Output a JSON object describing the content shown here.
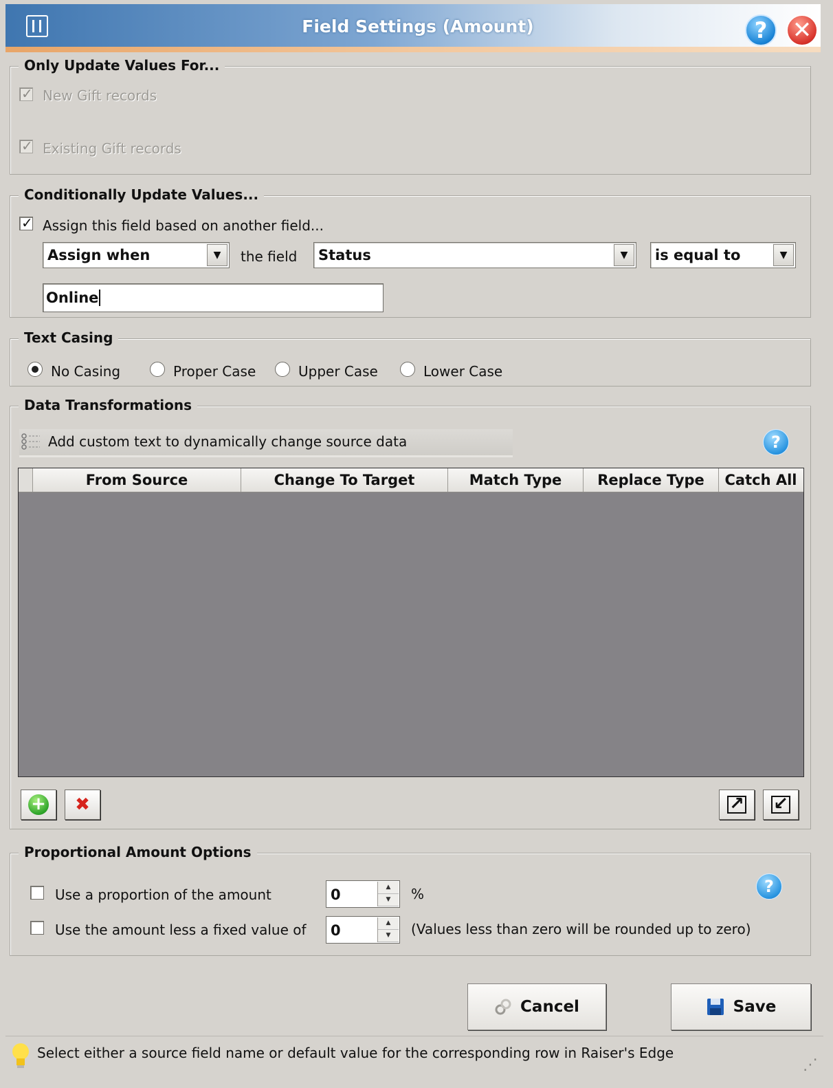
{
  "window": {
    "title": "Field Settings (Amount)",
    "help_icon": "?",
    "close_icon": "✕",
    "title_gradient_start": "#3f76b0",
    "accent": "#e8a568"
  },
  "update_for": {
    "legend": "Only Update Values For...",
    "new_label": "New Gift records",
    "existing_label": "Existing Gift records",
    "new_checked": true,
    "existing_checked": true,
    "tick": "✓"
  },
  "conditional": {
    "legend": "Conditionally Update Values...",
    "assign_label": "Assign this field based on another field...",
    "assign_checked": true,
    "tick": "✓",
    "when_value": "Assign when",
    "the_field_label": "the field",
    "field_value": "Status",
    "operator_value": "is equal to",
    "match_text": "Online",
    "arrow": "▼"
  },
  "casing": {
    "legend": "Text Casing",
    "options": [
      "No Casing",
      "Proper Case",
      "Upper Case",
      "Lower Case"
    ],
    "selected": "No Casing"
  },
  "transforms": {
    "legend": "Data Transformations",
    "custom_text_label": "Add custom text to dynamically change source data",
    "help_icon": "?",
    "columns": [
      "From Source",
      "Change To Target",
      "Match Type",
      "Replace Type",
      "Catch All"
    ],
    "rows": [],
    "add_icon": "+",
    "delete_icon": "✖",
    "export_icon": "↗",
    "import_icon": "↙"
  },
  "proportional": {
    "legend": "Proportional Amount Options",
    "proportion_label": "Use a proportion of the amount",
    "proportion_value": "0",
    "percent": "%",
    "less_label": "Use the amount less a fixed value of",
    "less_value": "0",
    "note": "(Values less than zero will be rounded up to zero)",
    "help_icon": "?",
    "up": "▲",
    "down": "▼"
  },
  "actions": {
    "cancel_label": "Cancel",
    "save_label": "Save"
  },
  "status": {
    "text": "Select either a source field name or default value for the corresponding row in Raiser's Edge",
    "grip": "⋰"
  }
}
